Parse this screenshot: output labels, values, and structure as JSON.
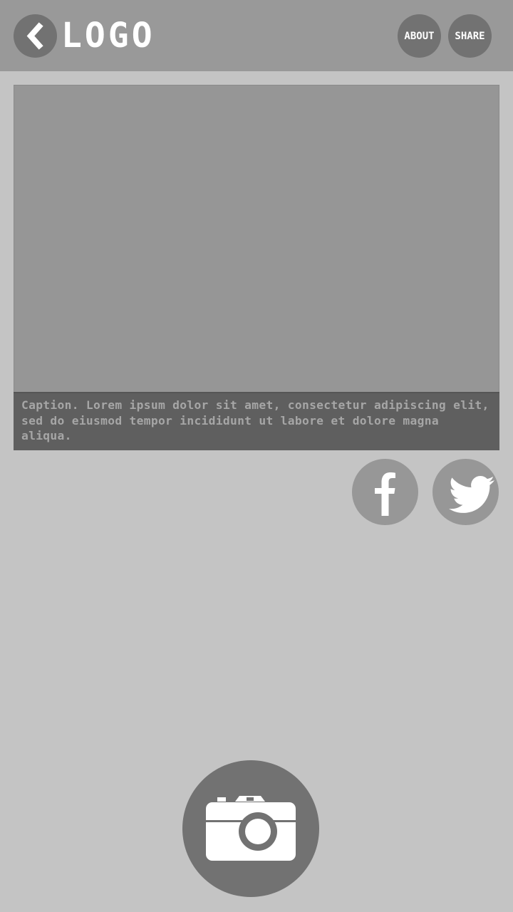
{
  "header": {
    "logo_text": "LOGO",
    "back_icon": "chevron-left-icon",
    "about_label": "ABOUT",
    "share_label": "SHARE"
  },
  "media": {
    "caption": "Caption. Lorem ipsum dolor sit amet, consectetur adipiscing elit, sed do eiusmod tempor incididunt ut labore et dolore magna aliqua."
  },
  "social": {
    "facebook_icon": "facebook-icon",
    "twitter_icon": "twitter-icon"
  },
  "camera": {
    "icon": "camera-icon"
  },
  "colors": {
    "background": "#c4c4c4",
    "header": "#999999",
    "button_dark": "#727272",
    "button_light": "#979797",
    "media_placeholder": "#969696",
    "caption_bg": "#5f5f5f",
    "caption_text": "#a6a6a6",
    "icon": "#ffffff"
  }
}
